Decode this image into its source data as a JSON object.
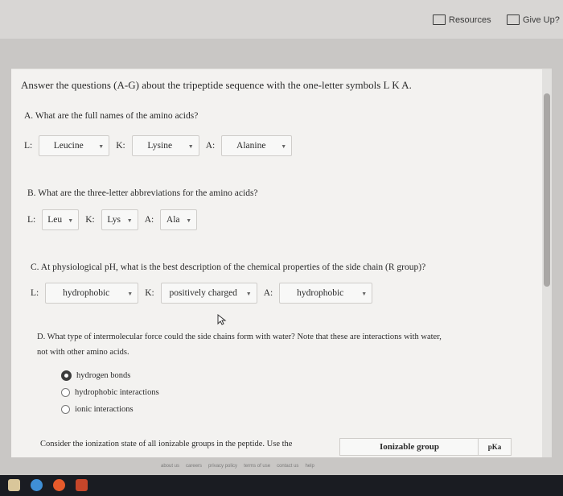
{
  "topbar": {
    "resources_label": "Resources",
    "give_up_label": "Give Up?"
  },
  "question": {
    "intro": "Answer the questions (A-G) about the tripeptide sequence with the one-letter symbols L K A.",
    "a": {
      "prompt": "A. What are the full names of the amino acids?",
      "items": [
        {
          "key": "L:",
          "value": "Leucine"
        },
        {
          "key": "K:",
          "value": "Lysine"
        },
        {
          "key": "A:",
          "value": "Alanine"
        }
      ]
    },
    "b": {
      "prompt": "B. What are the three-letter abbreviations for the amino acids?",
      "items": [
        {
          "key": "L:",
          "value": "Leu"
        },
        {
          "key": "K:",
          "value": "Lys"
        },
        {
          "key": "A:",
          "value": "Ala"
        }
      ]
    },
    "c": {
      "prompt": "C. At physiological pH, what is the best description of the chemical properties of the side chain (R group)?",
      "items": [
        {
          "key": "L:",
          "value": "hydrophobic"
        },
        {
          "key": "K:",
          "value": "positively charged"
        },
        {
          "key": "A:",
          "value": "hydrophobic"
        }
      ]
    },
    "d": {
      "prompt_line1": "D. What type of intermolecular force could the side chains form with water? Note that these are interactions with water,",
      "prompt_line2": "not with other amino acids.",
      "options": [
        "hydrogen bonds",
        "hydrophobic interactions",
        "ionic interactions"
      ],
      "selected": 0
    },
    "e": {
      "prompt": "Consider the ionization state of all ionizable groups in the peptide. Use the",
      "table_header_1": "Ionizable group",
      "table_header_2": "pKa"
    }
  },
  "footer": {
    "links": [
      "about us",
      "careers",
      "privacy policy",
      "terms of use",
      "contact us",
      "help"
    ]
  },
  "colors": {
    "panel_bg": "#f3f2f0",
    "taskbar": "#1a1c22"
  }
}
